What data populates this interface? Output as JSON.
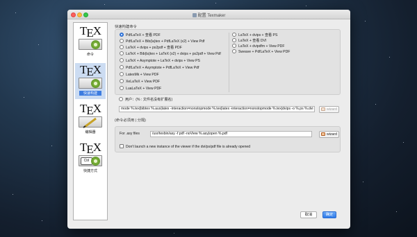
{
  "window": {
    "title": "配置 Texmaker"
  },
  "sidebar": {
    "logo_text": "TeX",
    "items": [
      {
        "label": "命令",
        "icon": "gear-icon"
      },
      {
        "label": "快速构建",
        "icon": "gear-icon"
      },
      {
        "label": "编辑器",
        "icon": "pen-icon"
      },
      {
        "label": "快捷方式",
        "icon": "gear-icon",
        "key": "Ctrl"
      }
    ]
  },
  "quickbuild": {
    "section_title": "快速构建命令",
    "options_left": [
      "PdfLaTeX + 查看 PDF",
      "PdfLaTeX + Bib(la)tex + PdfLaTeX (x2) + View Pdf",
      "LaTeX + dvips + ps2pdf + 查看 PDF",
      "LaTeX + Bib(la)tex + LaTeX (x2) + dvips + ps2pdf + View Pdf",
      "LaTeX + Asymptote + LaTeX + dvips + View PS",
      "PdfLaTeX + Asymptote + PdfLaTeX + View Pdf",
      "LatexMk + View PDF",
      "XeLaTeX + View PDF",
      "LuaLaTeX + View PDF"
    ],
    "options_right": [
      "LaTeX + dvips + 查看 PS",
      "LaTeX + 查看 DVI",
      "LaTeX + dvipdfm + View PDF",
      "Sweave + PdfLaTeX + View PDF"
    ],
    "selected_index": 0,
    "user_label": "用户：(% : 文件名没有扩展名)",
    "user_command": "mode %.tex|bibtex %.aux|latex -interaction=nonstopmode %.tex|latex -interaction=nonstopmode %.tex|dvips -o %.ps %.dvi",
    "wizard_label": "wizard",
    "separator_note": "(命令必须用 | 分隔)"
  },
  "asy": {
    "label": "For .asy files",
    "command": "/usr/texbin/asy -f pdf -noView %.asy|open %.pdf",
    "wizard_label": "wizard"
  },
  "viewer_option": {
    "label": "Don't launch a new instance of the viewer if the dvi/ps/pdf file is already opened",
    "checked": false
  },
  "footer": {
    "cancel_label": "取消",
    "ok_label": "确定"
  },
  "colors": {
    "accent": "#2f7be8",
    "selection": "#ccdcf2"
  }
}
